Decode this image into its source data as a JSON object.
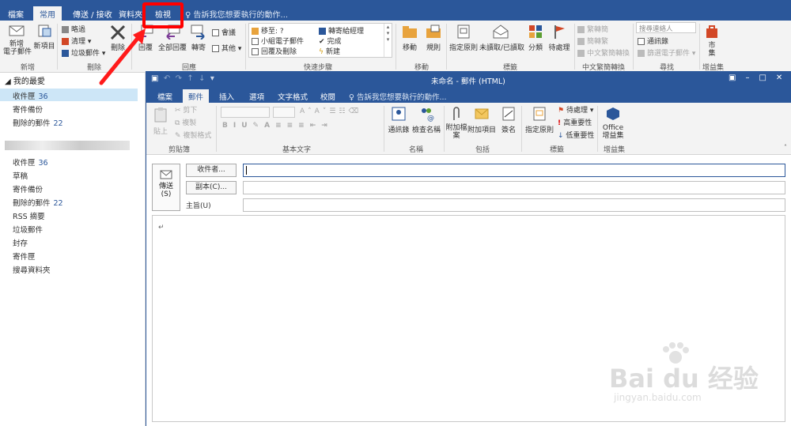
{
  "outlook": {
    "tabs": [
      "檔案",
      "常用",
      "傳送 / 接收",
      "資料夾",
      "檢視"
    ],
    "active_tab": "常用",
    "search_hint": "告訴我您想要執行的動作...",
    "ribbon": {
      "new_email": "新增\n電子郵件",
      "new_item": "新項目",
      "group_new": "新增",
      "ignore": "略過",
      "cleanup": "清理",
      "junk": "垃圾郵件",
      "delete": "刪除",
      "group_delete": "刪除",
      "reply": "回覆",
      "reply_all": "全部回覆",
      "forward": "轉寄",
      "meeting": "會議",
      "more": "其他",
      "group_respond": "回應",
      "quick_steps": [
        "移至: ?",
        "小組電子郵件",
        "回覆及刪除",
        "轉寄給經理",
        "完成",
        "新建"
      ],
      "group_quick_steps": "快速步驟",
      "move": "移動",
      "rules": "規則",
      "group_move": "移動",
      "assign_policy": "指定原則",
      "unread_read": "未讀取/已讀取",
      "categorize": "分類",
      "followup": "待處理",
      "group_tags": "標籤",
      "trad_simp": "繁轉簡",
      "simp_trad": "簡轉繁",
      "chinese_conv": "中文繁簡轉換",
      "group_chinese": "中文繁簡轉換",
      "search_people": "搜尋連絡人",
      "address_book": "通訊錄",
      "filter_email": "篩選電子郵件",
      "group_find": "尋找",
      "store": "市\n集",
      "group_addins": "增益集"
    },
    "nav": {
      "favorites_header": "我的最愛",
      "favorites": [
        {
          "label": "收件匣",
          "count": "36"
        },
        {
          "label": "寄件備份",
          "count": ""
        },
        {
          "label": "刪除的郵件",
          "count": "22"
        }
      ],
      "folders": [
        {
          "label": "收件匣",
          "count": "36"
        },
        {
          "label": "草稿",
          "count": ""
        },
        {
          "label": "寄件備份",
          "count": ""
        },
        {
          "label": "刪除的郵件",
          "count": "22"
        },
        {
          "label": "RSS 摘要",
          "count": ""
        },
        {
          "label": "垃圾郵件",
          "count": ""
        },
        {
          "label": "封存",
          "count": ""
        },
        {
          "label": "寄件匣",
          "count": ""
        },
        {
          "label": "搜尋資料夾",
          "count": ""
        }
      ]
    }
  },
  "compose": {
    "title": "未命名 - 郵件 (HTML)",
    "tabs": [
      "檔案",
      "郵件",
      "插入",
      "選項",
      "文字格式",
      "校閱"
    ],
    "active_tab": "郵件",
    "search_hint": "告訴我您想要執行的動作...",
    "ribbon": {
      "paste": "貼上",
      "cut": "剪下",
      "copy": "複製",
      "format_painter": "複製格式",
      "group_clipboard": "剪貼簿",
      "group_basic_text": "基本文字",
      "address_book": "通訊錄",
      "check_names": "檢查名稱",
      "group_names": "名稱",
      "attach_file": "附加檔\n案",
      "attach_item": "附加項目",
      "signature": "簽名",
      "group_include": "包括",
      "assign_policy": "指定原則",
      "followup": "待處理",
      "high_importance": "高重要性",
      "low_importance": "低重要性",
      "group_tags": "標籤",
      "office_addins": "Office\n增益集",
      "group_addins": "增益集"
    },
    "send": "傳送\n(S)",
    "to_button": "收件者...",
    "cc_button": "副本(C)...",
    "subject_label": "主旨(U)",
    "body_mark": "↵"
  },
  "watermark": {
    "brand": "Bai du 经验",
    "url": "jingyan.baidu.com"
  },
  "colors": {
    "accent": "#2b579a",
    "annotation": "#ff0000"
  }
}
